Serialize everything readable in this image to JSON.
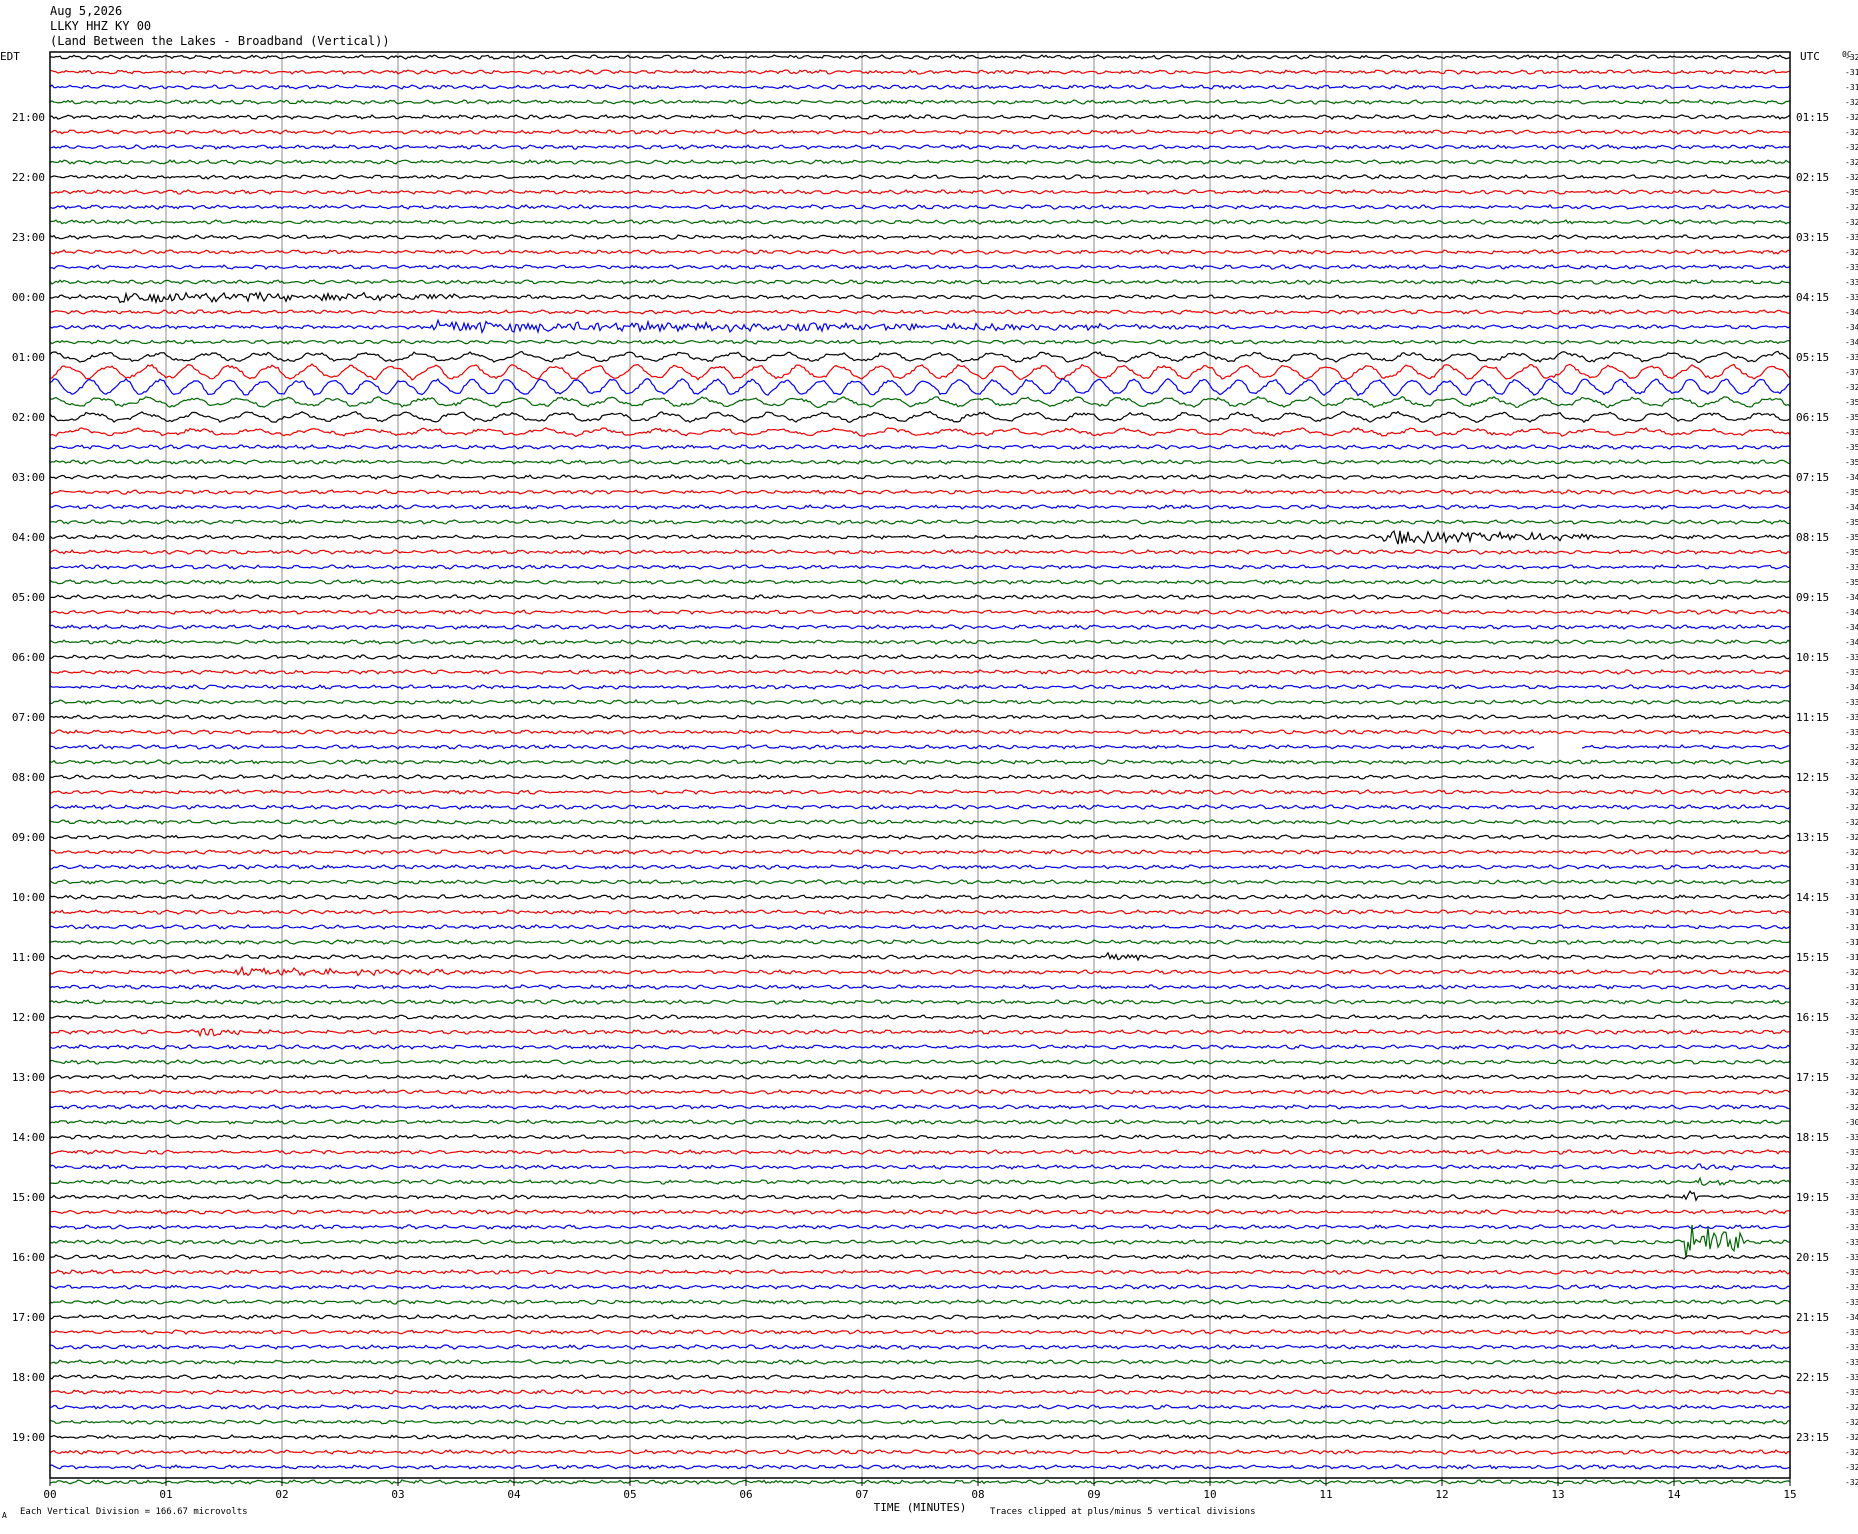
{
  "header": {
    "date": "Aug 5,2026",
    "station": "LLKY HHZ KY 00",
    "location": "(Land Between the Lakes - Broadband (Vertical))"
  },
  "axes": {
    "left_timezone": "EDT",
    "right_timezone": "UTC",
    "top_right_code": "0C",
    "x_title": "TIME (MINUTES)",
    "x_ticks": [
      "00",
      "01",
      "02",
      "03",
      "04",
      "05",
      "06",
      "07",
      "08",
      "09",
      "10",
      "11",
      "12",
      "13",
      "14",
      "15"
    ],
    "left_hour_labels": [
      "21:00",
      "22:00",
      "23:00",
      "00:00",
      "01:00",
      "02:00",
      "03:00",
      "04:00",
      "05:00",
      "06:00",
      "07:00",
      "08:00",
      "09:00",
      "10:00",
      "11:00",
      "12:00",
      "13:00",
      "14:00",
      "15:00",
      "16:00",
      "17:00",
      "18:00",
      "19:00"
    ],
    "right_hour_labels": [
      "01:15",
      "02:15",
      "03:15",
      "04:15",
      "05:15",
      "06:15",
      "07:15",
      "08:15",
      "09:15",
      "10:15",
      "11:15",
      "12:15",
      "13:15",
      "14:15",
      "15:15",
      "16:15",
      "17:15",
      "18:15",
      "19:15",
      "20:15",
      "21:15",
      "22:15",
      "23:15"
    ]
  },
  "footer": {
    "scale_note": "Each Vertical Division =  166.67 microvolts",
    "clip_note": "Traces clipped at plus/minus 5 vertical divisions",
    "corner_mark": "A"
  },
  "colors": {
    "trace_cycle": [
      "#000000",
      "#ee0000",
      "#0000ee",
      "#006600"
    ],
    "gridline": "#8c8c8c"
  },
  "chart_data": {
    "type": "helicorder",
    "minutes_per_line": 15,
    "line_count": 96,
    "first_line_label_edt": "20:45",
    "row_offsets": [
      "322",
      "318",
      "315",
      "320",
      "320",
      "323",
      "324",
      "323",
      "329",
      "358",
      "326",
      "328",
      "336",
      "327",
      "334",
      "336",
      "335",
      "340",
      "343",
      "341",
      "339",
      "378",
      "321",
      "357",
      "354",
      "333",
      "355",
      "351",
      "347",
      "351",
      "349",
      "353",
      "353",
      "353",
      "332",
      "351",
      "341",
      "342",
      "344",
      "347",
      "338",
      "337",
      "340",
      "332",
      "335",
      "335",
      "328",
      "323",
      "328",
      "326",
      "324",
      "321",
      "323",
      "320",
      "317",
      "313",
      "317",
      "318",
      "317",
      "317",
      "316",
      "324",
      "318",
      "321",
      "322",
      "339",
      "322",
      "324",
      "325",
      "326",
      "326",
      "308",
      "331",
      "330",
      "329",
      "333",
      "333",
      "331",
      "331",
      "334",
      "333",
      "330",
      "336",
      "334",
      "344",
      "333",
      "331",
      "330",
      "331",
      "332",
      "329",
      "329",
      "326",
      "328",
      "324",
      "324"
    ],
    "events": [
      {
        "line": 16,
        "start_min": 0.6,
        "end_min": 3.5,
        "amplitude": 0.55
      },
      {
        "line": 18,
        "start_min": 3.3,
        "end_min": 10.0,
        "amplitude": 0.5
      },
      {
        "line": 20,
        "start_min": 0.0,
        "end_min": 15.0,
        "amplitude": 0.45,
        "period_min": 0.45
      },
      {
        "line": 21,
        "start_min": 0.0,
        "end_min": 15.0,
        "amplitude": 0.75,
        "period_min": 0.35
      },
      {
        "line": 22,
        "start_min": 0.0,
        "end_min": 15.0,
        "amplitude": 0.85,
        "period_min": 0.3
      },
      {
        "line": 23,
        "start_min": 0.0,
        "end_min": 15.0,
        "amplitude": 0.45,
        "period_min": 0.4
      },
      {
        "line": 24,
        "start_min": 0.0,
        "end_min": 15.0,
        "amplitude": 0.45,
        "period_min": 0.45
      },
      {
        "line": 25,
        "start_min": 0.0,
        "end_min": 15.0,
        "amplitude": 0.3,
        "period_min": 0.5
      },
      {
        "line": 32,
        "start_min": 11.5,
        "end_min": 13.3,
        "amplitude": 0.65
      },
      {
        "line": 46,
        "gap_start_min": 12.8,
        "gap_end_min": 13.2
      },
      {
        "line": 56,
        "start_min": 7.15,
        "end_min": 7.3,
        "amplitude": 0.45
      },
      {
        "line": 60,
        "start_min": 9.1,
        "end_min": 9.4,
        "amplitude": 0.5
      },
      {
        "line": 61,
        "start_min": 1.6,
        "end_min": 3.6,
        "amplitude": 0.3
      },
      {
        "line": 62,
        "start_min": 11.0,
        "end_min": 11.1,
        "amplitude": 0.25
      },
      {
        "line": 65,
        "start_min": 1.2,
        "end_min": 1.9,
        "amplitude": 0.45
      },
      {
        "line": 74,
        "start_min": 14.2,
        "end_min": 14.5,
        "amplitude": 0.35
      },
      {
        "line": 75,
        "start_min": 14.2,
        "end_min": 14.5,
        "amplitude": 0.3
      },
      {
        "line": 76,
        "start_min": 14.1,
        "end_min": 14.2,
        "amplitude": 1.2
      },
      {
        "line": 79,
        "start_min": 14.1,
        "end_min": 14.6,
        "amplitude": 2.2
      }
    ]
  }
}
